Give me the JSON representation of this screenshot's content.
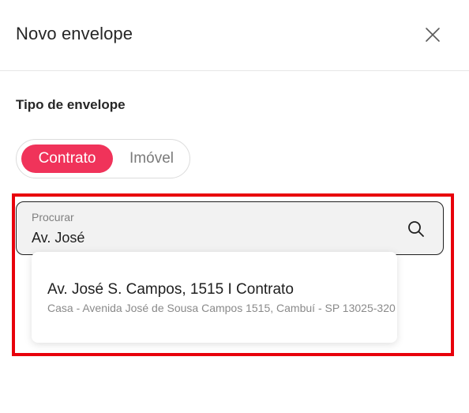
{
  "dialog": {
    "title": "Novo envelope",
    "close_icon": "close-icon"
  },
  "envelope_type": {
    "label": "Tipo de envelope",
    "options": [
      "Contrato",
      "Imóvel"
    ],
    "selected": "Contrato"
  },
  "search": {
    "label": "Procurar",
    "value": "Av. José",
    "icon": "search-icon"
  },
  "suggestions": [
    {
      "title": "Av. José S. Campos, 1515 I Contrato",
      "subtitle": "Casa - Avenida José de Sousa Campos 1515, Cambuí - SP 13025-320"
    }
  ],
  "colors": {
    "accent": "#f0335a",
    "highlight_border": "#e8000b",
    "search_bg": "#f2f2f2"
  }
}
